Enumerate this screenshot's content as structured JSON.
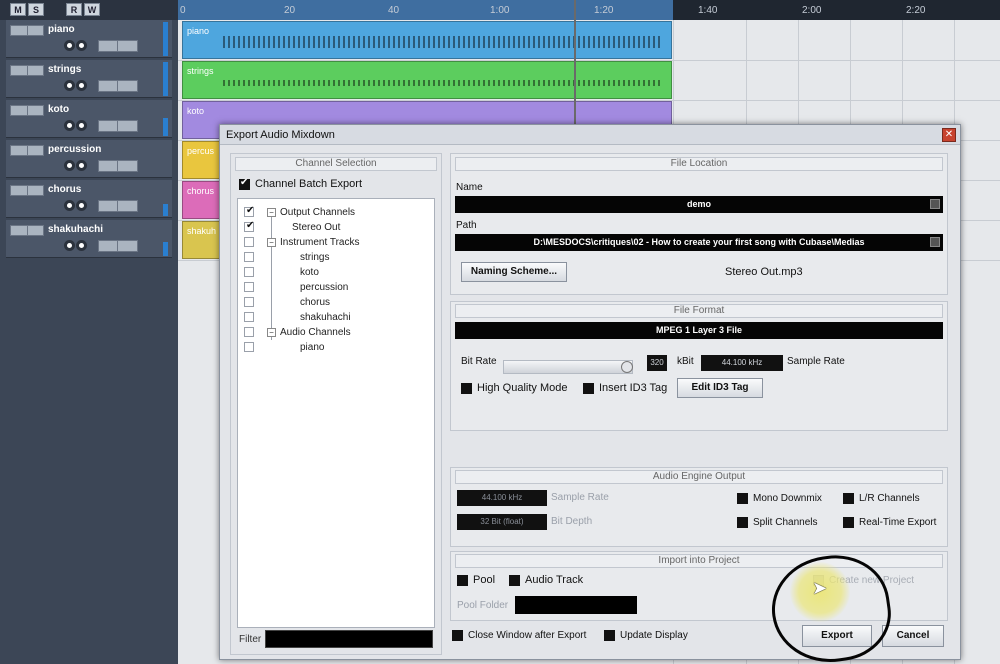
{
  "toolbar": {
    "buttons": [
      "M",
      "S",
      "R",
      "W"
    ]
  },
  "tracks": [
    {
      "name": "piano",
      "color": "#3b98d6"
    },
    {
      "name": "strings",
      "color": "#58c95a"
    },
    {
      "name": "koto",
      "color": "#9a7fd8"
    },
    {
      "name": "percussion",
      "color": "#e7c33b"
    },
    {
      "name": "chorus",
      "color": "#d864b5"
    },
    {
      "name": "shakuhachi",
      "color": "#d7c24b"
    }
  ],
  "ruler": {
    "ticks": [
      "0",
      "20",
      "40",
      "1:00",
      "1:20",
      "1:40",
      "2:00",
      "2:20"
    ]
  },
  "clips": [
    "piano",
    "strings",
    "koto",
    "percus",
    "chorus",
    "shakuh"
  ],
  "dialog": {
    "title": "Export Audio Mixdown",
    "close_icon": "close-icon",
    "channel_selection": {
      "header": "Channel Selection",
      "batch_export_label": "Channel Batch Export",
      "batch_export_checked": true,
      "tree": [
        {
          "label": "Output Channels",
          "checked": true,
          "level": 0,
          "expander": "−"
        },
        {
          "label": "Stereo Out",
          "checked": true,
          "level": 1
        },
        {
          "label": "Instrument Tracks",
          "checked": false,
          "level": 0,
          "expander": "−"
        },
        {
          "label": "strings",
          "checked": false,
          "level": 1
        },
        {
          "label": "koto",
          "checked": false,
          "level": 1
        },
        {
          "label": "percussion",
          "checked": false,
          "level": 1
        },
        {
          "label": "chorus",
          "checked": false,
          "level": 1
        },
        {
          "label": "shakuhachi",
          "checked": false,
          "level": 1
        },
        {
          "label": "Audio Channels",
          "checked": false,
          "level": 0,
          "expander": "−"
        },
        {
          "label": "piano",
          "checked": false,
          "level": 1
        }
      ],
      "filter_label": "Filter",
      "filter_value": ""
    },
    "file_location": {
      "header": "File Location",
      "name_label": "Name",
      "name_value": "demo",
      "path_label": "Path",
      "path_value": "D:\\MESDOCS\\critiques\\02 - How to create your first song with Cubase\\Medias",
      "naming_scheme_button": "Naming Scheme...",
      "output_file": "Stereo Out.mp3"
    },
    "file_format": {
      "header": "File Format",
      "format_value": "MPEG 1 Layer 3 File",
      "bit_rate_label": "Bit Rate",
      "bit_rate_value": "320",
      "bit_rate_unit": "kBit",
      "sample_rate_value": "44.100 kHz",
      "sample_rate_label": "Sample Rate",
      "high_quality_label": "High Quality Mode",
      "insert_id3_label": "Insert ID3 Tag",
      "edit_id3_button": "Edit ID3 Tag"
    },
    "audio_engine": {
      "header": "Audio Engine Output",
      "sample_rate_value": "44.100 kHz",
      "sample_rate_label": "Sample Rate",
      "bit_depth_value": "32 Bit (float)",
      "bit_depth_label": "Bit Depth",
      "mono_downmix_label": "Mono Downmix",
      "lr_channels_label": "L/R Channels",
      "split_channels_label": "Split Channels",
      "realtime_export_label": "Real-Time Export"
    },
    "import_project": {
      "header": "Import into Project",
      "pool_label": "Pool",
      "audio_track_label": "Audio Track",
      "create_project_label": "Create new Project",
      "pool_folder_label": "Pool Folder"
    },
    "footer": {
      "close_window_label": "Close Window after Export",
      "update_display_label": "Update Display",
      "export_button": "Export",
      "cancel_button": "Cancel"
    }
  },
  "colors": {
    "accent_blue": "#3b98d6",
    "dialog_bg": "#e3e5e9",
    "field_black": "#050505"
  }
}
